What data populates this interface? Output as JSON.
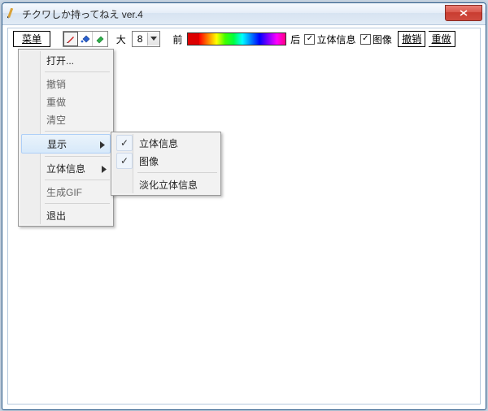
{
  "window": {
    "title": "チクワしか持ってねえ ver.4"
  },
  "toolbar": {
    "menu_button": "菜单",
    "size_label": "大",
    "size_value": "8",
    "front_label": "前",
    "back_label": "后",
    "chk_stereo_label": "立体信息",
    "chk_image_label": "图像",
    "undo_label": "撤销",
    "redo_label": "重做"
  },
  "menu": {
    "items": [
      {
        "label": "打开...",
        "enabled": true
      },
      {
        "sep": true
      },
      {
        "label": "撤销",
        "enabled": false
      },
      {
        "label": "重做",
        "enabled": false
      },
      {
        "label": "清空",
        "enabled": false
      },
      {
        "sep": true
      },
      {
        "label": "显示",
        "enabled": true,
        "submenu": true,
        "highlight": true
      },
      {
        "sep": true
      },
      {
        "label": "立体信息",
        "enabled": true,
        "submenu": true
      },
      {
        "sep": true
      },
      {
        "label": "生成GIF",
        "enabled": false
      },
      {
        "sep": true
      },
      {
        "label": "退出",
        "enabled": true
      }
    ]
  },
  "submenu_display": {
    "items": [
      {
        "label": "立体信息",
        "checked": true
      },
      {
        "label": "图像",
        "checked": true
      },
      {
        "sep": true
      },
      {
        "label": "淡化立体信息",
        "checked": false
      }
    ]
  }
}
